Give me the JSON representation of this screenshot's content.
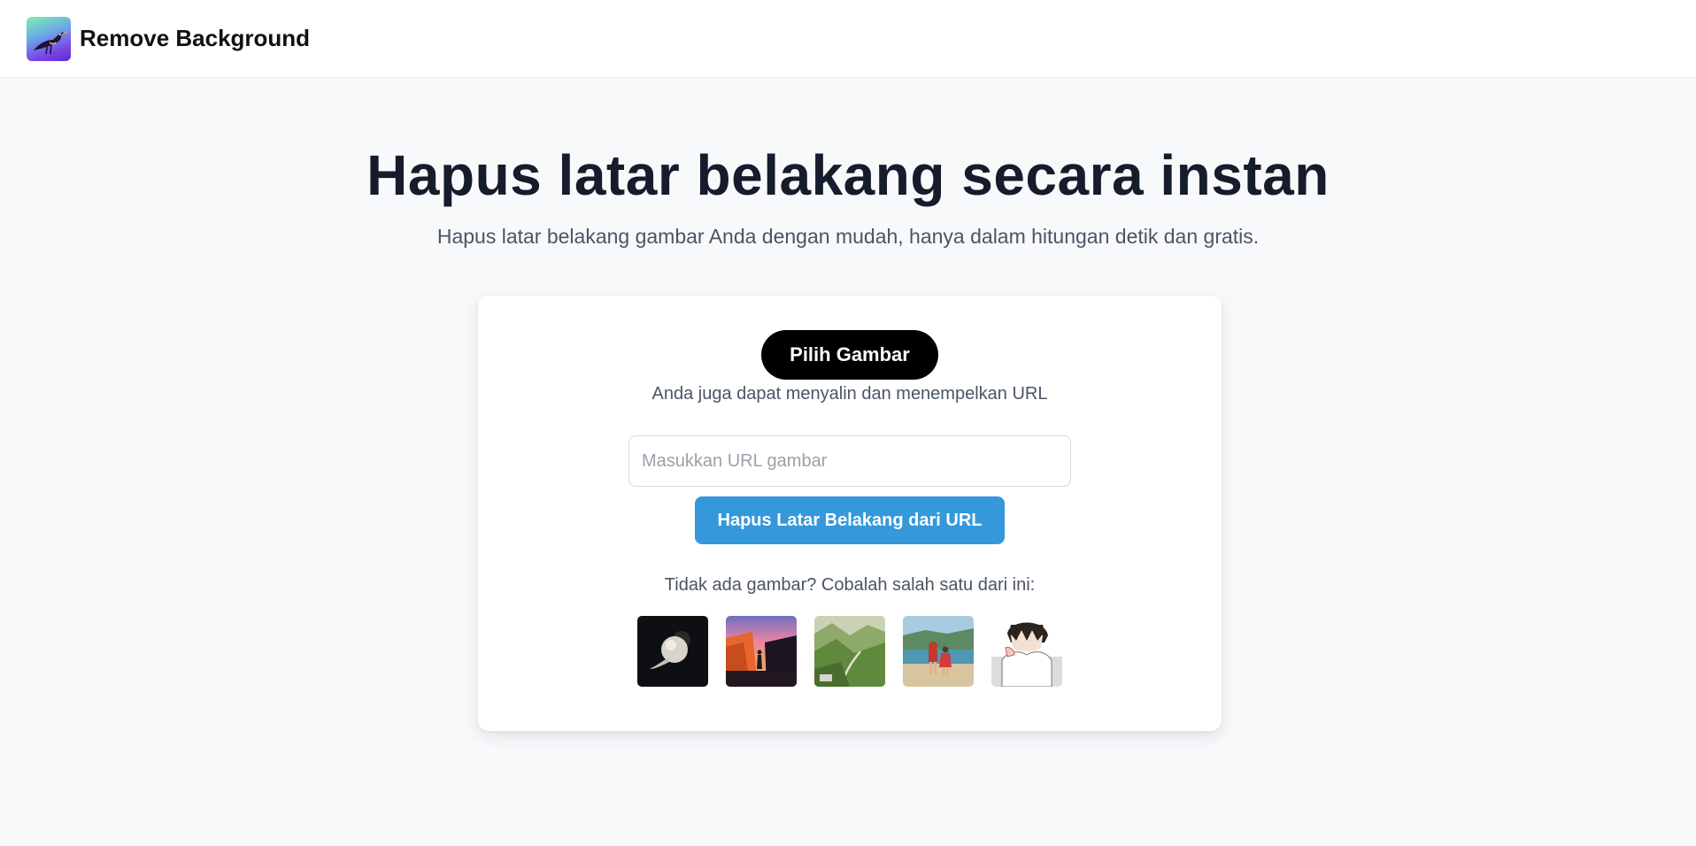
{
  "header": {
    "brand": "Remove Background",
    "logo_icon": "bird-logo-icon"
  },
  "hero": {
    "title": "Hapus latar belakang secara instan",
    "subtitle": "Hapus latar belakang gambar Anda dengan mudah, hanya dalam hitungan detik dan gratis."
  },
  "card": {
    "pick_button": "Pilih Gambar",
    "hint": "Anda juga dapat menyalin dan menempelkan URL",
    "url_input": {
      "placeholder": "Masukkan URL gambar",
      "value": ""
    },
    "url_button": "Hapus Latar Belakang dari URL",
    "samples_label": "Tidak ada gambar? Cobalah salah satu dari ini:",
    "samples": [
      {
        "name": "sample-ball"
      },
      {
        "name": "sample-canyon-sunset"
      },
      {
        "name": "sample-green-valley"
      },
      {
        "name": "sample-beach-couple"
      },
      {
        "name": "sample-anime-character"
      }
    ]
  },
  "colors": {
    "page_bg": "#f8f9fb",
    "pick_button_bg": "#000000",
    "url_button_bg": "#3498db",
    "title_color": "#151c2c"
  }
}
